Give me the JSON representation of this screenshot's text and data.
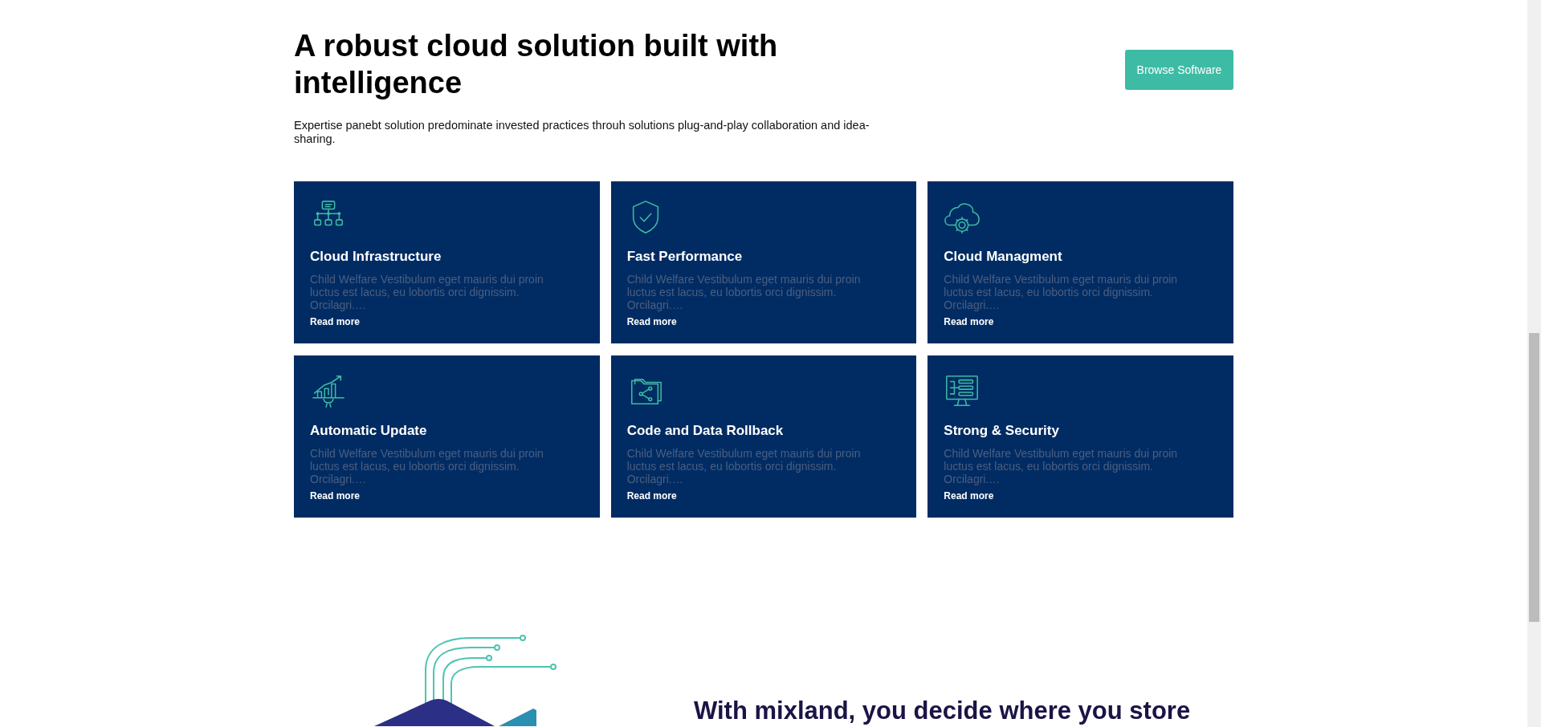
{
  "intro": {
    "heading": "A robust cloud solution built with intelligence",
    "button": "Browse Software",
    "paragraph": "Expertise panebt solution predominate invested practices throuh solutions plug-and-play collaboration and idea-sharing."
  },
  "features": [
    {
      "kind": "network",
      "title": "Cloud Infrastructure",
      "description": "Child Welfare Vestibulum eget mauris dui proin luctus est lacus, eu lobortis orci dignissim. Orcilagri.…",
      "link": "Read more"
    },
    {
      "kind": "shield",
      "title": "Fast Performance",
      "description": "Child Welfare Vestibulum eget mauris dui proin luctus est lacus, eu lobortis orci dignissim. Orcilagri.…",
      "link": "Read more"
    },
    {
      "kind": "cloud",
      "title": "Cloud Managment",
      "description": "Child Welfare Vestibulum eget mauris dui proin luctus est lacus, eu lobortis orci dignissim. Orcilagri.…",
      "link": "Read more"
    },
    {
      "kind": "chart",
      "title": "Automatic Update",
      "description": "Child Welfare Vestibulum eget mauris dui proin luctus est lacus, eu lobortis orci dignissim. Orcilagri.…",
      "link": "Read more"
    },
    {
      "kind": "folder",
      "title": "Code and Data Rollback",
      "description": "Child Welfare Vestibulum eget mauris dui proin luctus est lacus, eu lobortis orci dignissim. Orcilagri.…",
      "link": "Read more"
    },
    {
      "kind": "monitor",
      "title": "Strong & Security",
      "description": "Child Welfare Vestibulum eget mauris dui proin luctus est lacus, eu lobortis orci dignissim. Orcilagri.…",
      "link": "Read more"
    }
  ],
  "storage": {
    "heading": "With mixland, you decide where you store"
  }
}
